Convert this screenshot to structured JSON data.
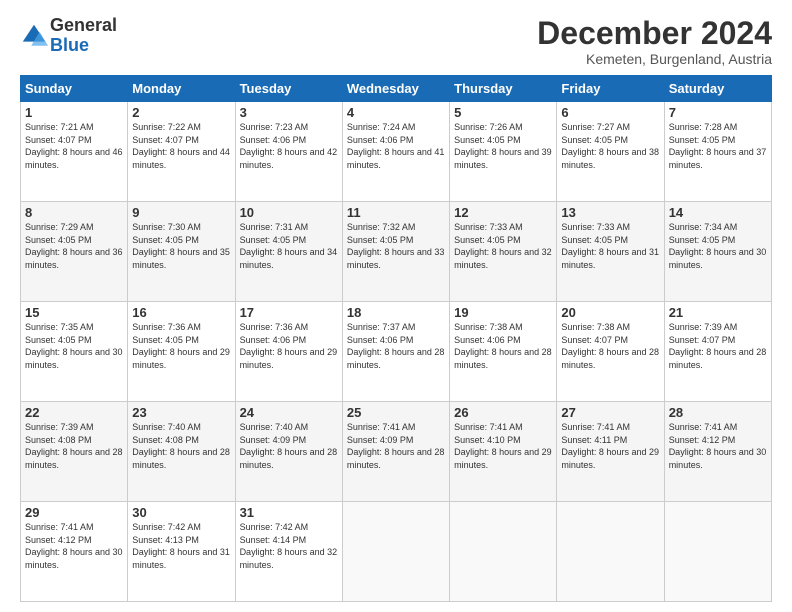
{
  "logo": {
    "general": "General",
    "blue": "Blue"
  },
  "title": "December 2024",
  "location": "Kemeten, Burgenland, Austria",
  "days_of_week": [
    "Sunday",
    "Monday",
    "Tuesday",
    "Wednesday",
    "Thursday",
    "Friday",
    "Saturday"
  ],
  "weeks": [
    [
      {
        "day": "1",
        "sunrise": "7:21 AM",
        "sunset": "4:07 PM",
        "daylight": "8 hours and 46 minutes."
      },
      {
        "day": "2",
        "sunrise": "7:22 AM",
        "sunset": "4:07 PM",
        "daylight": "8 hours and 44 minutes."
      },
      {
        "day": "3",
        "sunrise": "7:23 AM",
        "sunset": "4:06 PM",
        "daylight": "8 hours and 42 minutes."
      },
      {
        "day": "4",
        "sunrise": "7:24 AM",
        "sunset": "4:06 PM",
        "daylight": "8 hours and 41 minutes."
      },
      {
        "day": "5",
        "sunrise": "7:26 AM",
        "sunset": "4:05 PM",
        "daylight": "8 hours and 39 minutes."
      },
      {
        "day": "6",
        "sunrise": "7:27 AM",
        "sunset": "4:05 PM",
        "daylight": "8 hours and 38 minutes."
      },
      {
        "day": "7",
        "sunrise": "7:28 AM",
        "sunset": "4:05 PM",
        "daylight": "8 hours and 37 minutes."
      }
    ],
    [
      {
        "day": "8",
        "sunrise": "7:29 AM",
        "sunset": "4:05 PM",
        "daylight": "8 hours and 36 minutes."
      },
      {
        "day": "9",
        "sunrise": "7:30 AM",
        "sunset": "4:05 PM",
        "daylight": "8 hours and 35 minutes."
      },
      {
        "day": "10",
        "sunrise": "7:31 AM",
        "sunset": "4:05 PM",
        "daylight": "8 hours and 34 minutes."
      },
      {
        "day": "11",
        "sunrise": "7:32 AM",
        "sunset": "4:05 PM",
        "daylight": "8 hours and 33 minutes."
      },
      {
        "day": "12",
        "sunrise": "7:33 AM",
        "sunset": "4:05 PM",
        "daylight": "8 hours and 32 minutes."
      },
      {
        "day": "13",
        "sunrise": "7:33 AM",
        "sunset": "4:05 PM",
        "daylight": "8 hours and 31 minutes."
      },
      {
        "day": "14",
        "sunrise": "7:34 AM",
        "sunset": "4:05 PM",
        "daylight": "8 hours and 30 minutes."
      }
    ],
    [
      {
        "day": "15",
        "sunrise": "7:35 AM",
        "sunset": "4:05 PM",
        "daylight": "8 hours and 30 minutes."
      },
      {
        "day": "16",
        "sunrise": "7:36 AM",
        "sunset": "4:05 PM",
        "daylight": "8 hours and 29 minutes."
      },
      {
        "day": "17",
        "sunrise": "7:36 AM",
        "sunset": "4:06 PM",
        "daylight": "8 hours and 29 minutes."
      },
      {
        "day": "18",
        "sunrise": "7:37 AM",
        "sunset": "4:06 PM",
        "daylight": "8 hours and 28 minutes."
      },
      {
        "day": "19",
        "sunrise": "7:38 AM",
        "sunset": "4:06 PM",
        "daylight": "8 hours and 28 minutes."
      },
      {
        "day": "20",
        "sunrise": "7:38 AM",
        "sunset": "4:07 PM",
        "daylight": "8 hours and 28 minutes."
      },
      {
        "day": "21",
        "sunrise": "7:39 AM",
        "sunset": "4:07 PM",
        "daylight": "8 hours and 28 minutes."
      }
    ],
    [
      {
        "day": "22",
        "sunrise": "7:39 AM",
        "sunset": "4:08 PM",
        "daylight": "8 hours and 28 minutes."
      },
      {
        "day": "23",
        "sunrise": "7:40 AM",
        "sunset": "4:08 PM",
        "daylight": "8 hours and 28 minutes."
      },
      {
        "day": "24",
        "sunrise": "7:40 AM",
        "sunset": "4:09 PM",
        "daylight": "8 hours and 28 minutes."
      },
      {
        "day": "25",
        "sunrise": "7:41 AM",
        "sunset": "4:09 PM",
        "daylight": "8 hours and 28 minutes."
      },
      {
        "day": "26",
        "sunrise": "7:41 AM",
        "sunset": "4:10 PM",
        "daylight": "8 hours and 29 minutes."
      },
      {
        "day": "27",
        "sunrise": "7:41 AM",
        "sunset": "4:11 PM",
        "daylight": "8 hours and 29 minutes."
      },
      {
        "day": "28",
        "sunrise": "7:41 AM",
        "sunset": "4:12 PM",
        "daylight": "8 hours and 30 minutes."
      }
    ],
    [
      {
        "day": "29",
        "sunrise": "7:41 AM",
        "sunset": "4:12 PM",
        "daylight": "8 hours and 30 minutes."
      },
      {
        "day": "30",
        "sunrise": "7:42 AM",
        "sunset": "4:13 PM",
        "daylight": "8 hours and 31 minutes."
      },
      {
        "day": "31",
        "sunrise": "7:42 AM",
        "sunset": "4:14 PM",
        "daylight": "8 hours and 32 minutes."
      },
      null,
      null,
      null,
      null
    ]
  ]
}
